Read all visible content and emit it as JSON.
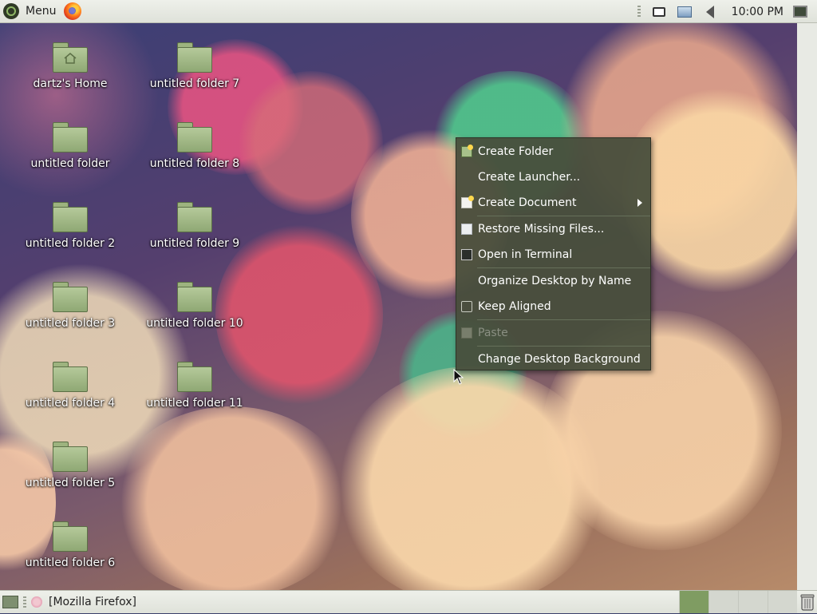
{
  "top_panel": {
    "menu_label": "Menu",
    "launchers": [
      {
        "icon": "firefox-icon"
      }
    ],
    "tray_icons": [
      "card-reader-icon",
      "network-icon",
      "volume-icon"
    ],
    "clock": "10:00 PM",
    "show_desktop_icon": "monitor-icon"
  },
  "desktop": {
    "icons": [
      {
        "label": "dartz's Home",
        "icon": "home-folder-icon"
      },
      {
        "label": "untitled folder",
        "icon": "folder-icon"
      },
      {
        "label": "untitled folder 2",
        "icon": "folder-icon"
      },
      {
        "label": "untitled folder 3",
        "icon": "folder-icon"
      },
      {
        "label": "untitled folder 4",
        "icon": "folder-icon"
      },
      {
        "label": "untitled folder 5",
        "icon": "folder-icon"
      },
      {
        "label": "untitled folder 6",
        "icon": "folder-icon"
      },
      {
        "label": "untitled folder 7",
        "icon": "folder-icon"
      },
      {
        "label": "untitled folder 8",
        "icon": "folder-icon"
      },
      {
        "label": "untitled folder 9",
        "icon": "folder-icon"
      },
      {
        "label": "untitled folder 10",
        "icon": "folder-icon"
      },
      {
        "label": "untitled folder 11",
        "icon": "folder-icon"
      }
    ]
  },
  "context_menu": {
    "items": [
      {
        "label": "Create Folder",
        "icon": "new-folder-icon",
        "enabled": true
      },
      {
        "label": "Create Launcher...",
        "icon": "",
        "enabled": true
      },
      {
        "label": "Create Document",
        "icon": "new-document-icon",
        "enabled": true,
        "submenu": true
      },
      {
        "label": "Restore Missing Files...",
        "icon": "document-restore-icon",
        "enabled": true
      },
      {
        "label": "Open in Terminal",
        "icon": "terminal-icon",
        "enabled": true
      },
      {
        "label": "Organize Desktop by Name",
        "icon": "",
        "enabled": true
      },
      {
        "label": "Keep Aligned",
        "icon": "checkbox-icon",
        "enabled": true,
        "checked": false
      },
      {
        "label": "Paste",
        "icon": "paste-icon",
        "enabled": false
      },
      {
        "label": "Change Desktop Background",
        "icon": "",
        "enabled": true
      }
    ]
  },
  "bottom_panel": {
    "window_title": "[Mozilla Firefox]",
    "workspaces": {
      "count": 4,
      "active": 1
    }
  },
  "colors": {
    "panel_bg": "#e6e8e2",
    "menu_bg": "#484e3c",
    "folder_green": "#9db37f",
    "active_workspace": "#7f9c62"
  }
}
